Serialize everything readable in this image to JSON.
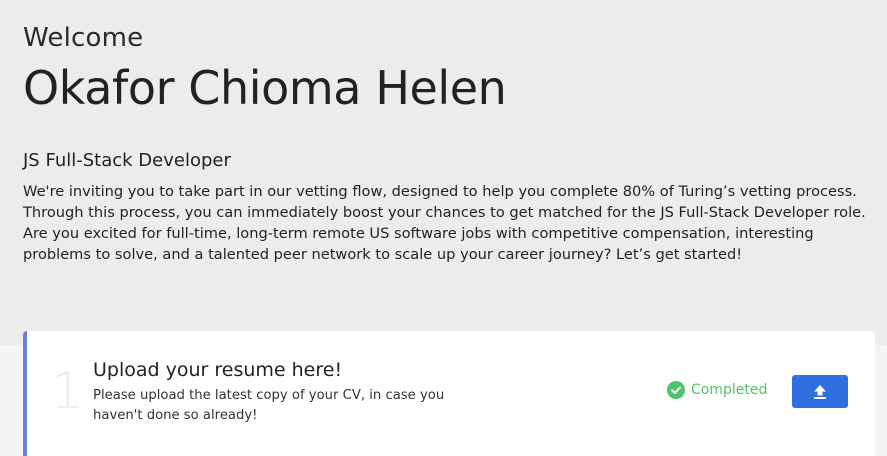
{
  "header": {
    "welcome": "Welcome",
    "name": "Okafor Chioma Helen"
  },
  "role": {
    "title": "JS Full-Stack Developer",
    "description": "We're inviting you to take part in our vetting flow, designed to help you complete 80% of Turing’s vetting process. Through this process, you can immediately boost your chances to get matched for the JS Full-Stack Developer role. Are you excited for full-time, long-term remote US software jobs with competitive compensation, interesting problems to solve, and a talented peer network to scale up your career journey? Let’s get started!"
  },
  "step": {
    "number": "1",
    "title": "Upload your resume here!",
    "description": "Please upload the latest copy of your CV, in case you haven't done so already!",
    "status": "Completed",
    "status_icon": "check-circle-icon",
    "action_icon": "upload-icon"
  },
  "colors": {
    "page_bg": "#ececec",
    "card_accent": "#6c7fd1",
    "status_green": "#4fc36b",
    "button_blue": "#2f6fe0"
  }
}
